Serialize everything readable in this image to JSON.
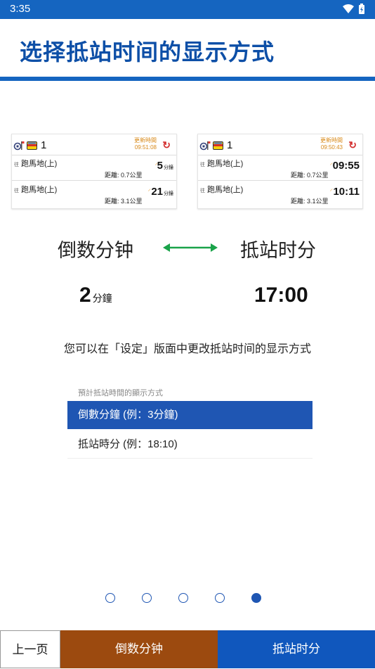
{
  "status": {
    "time": "3:35"
  },
  "title": "选择抵站时间的显示方式",
  "cards": {
    "left": {
      "route": "1",
      "update_label": "更新時間",
      "update_time": "09:51:08",
      "rows": [
        {
          "prefix": "往",
          "dest": "跑馬地(上)",
          "dist": "距離: 0.7公里",
          "eta": "5",
          "eta_unit": "分鐘"
        },
        {
          "prefix": "往",
          "dest": "跑馬地(上)",
          "dist": "距離: 3.1公里",
          "eta": "21",
          "eta_unit": "分鐘"
        }
      ]
    },
    "right": {
      "route": "1",
      "update_label": "更新時間",
      "update_time": "09:50:43",
      "rows": [
        {
          "prefix": "往",
          "dest": "跑馬地(上)",
          "dist": "距離: 0.7公里",
          "eta": "09:55"
        },
        {
          "prefix": "往",
          "dest": "跑馬地(上)",
          "dist": "距離: 3.1公里",
          "eta": "10:11"
        }
      ]
    }
  },
  "modes": {
    "countdown_label": "倒数分钟",
    "arrival_label": "抵站时分",
    "countdown_example_num": "2",
    "countdown_example_unit": "分鐘",
    "arrival_example": "17:00"
  },
  "note": "您可以在「设定」版面中更改抵站时间的显示方式",
  "settings": {
    "label": "預計抵站時間的顯示方式",
    "options": [
      {
        "label": "倒數分鐘 (例：3分鐘)",
        "selected": true
      },
      {
        "label": "抵站時分 (例：18:10)",
        "selected": false
      }
    ]
  },
  "pager": {
    "total": 5,
    "current": 5
  },
  "buttons": {
    "prev": "上一页",
    "countdown": "倒数分钟",
    "arrival": "抵站时分"
  },
  "colors": {
    "primary": "#1565c0",
    "countdown_button": "#9c4a0f",
    "arrow": "#1aa34a",
    "update_time": "#d88a1a"
  }
}
